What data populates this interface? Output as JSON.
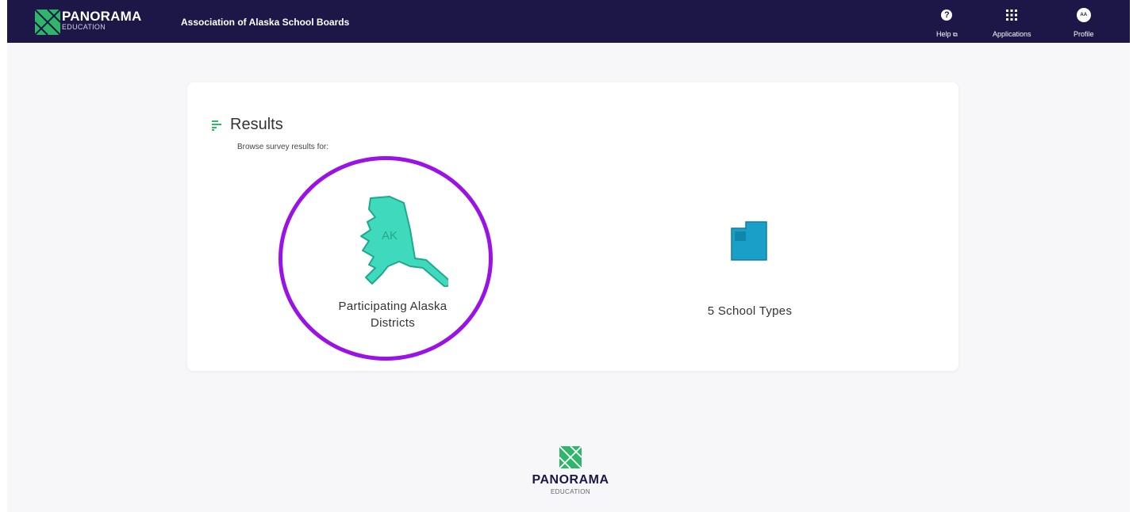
{
  "header": {
    "logo_title": "PANORAMA",
    "logo_subtitle": "EDUCATION",
    "org_name": "Association of Alaska School Boards",
    "help_label": "Help",
    "help_icon_glyph": "?",
    "external_icon_glyph": "⧉",
    "applications_label": "Applications",
    "profile_label": "Profile",
    "profile_initials": "AA"
  },
  "results": {
    "title": "Results",
    "subtitle": "Browse survey results for:",
    "tiles": [
      {
        "label": "Participating Alaska Districts",
        "icon": "alaska-map-icon",
        "state_abbr": "AK"
      },
      {
        "label": "5 School Types",
        "icon": "school-building-icon"
      }
    ]
  },
  "footer": {
    "logo_title": "PANORAMA",
    "logo_subtitle": "EDUCATION"
  },
  "colors": {
    "topbar": "#1d1747",
    "accent_green": "#2fb66a",
    "alaska_fill": "#3fd9bd",
    "school_fill": "#1aa0c8",
    "highlight": "#9b12e8"
  }
}
